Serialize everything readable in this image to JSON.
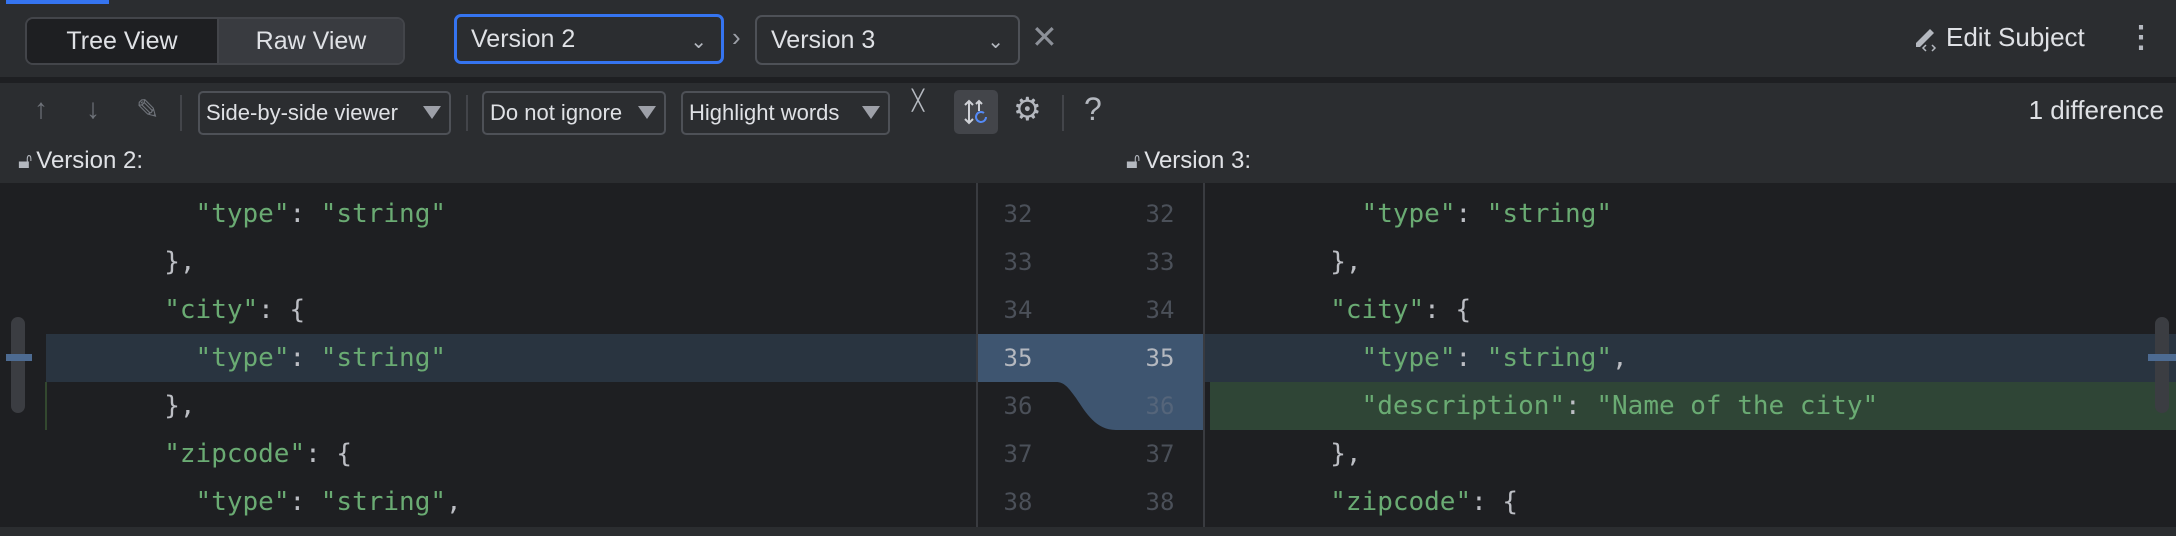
{
  "view_toggle": {
    "tree": "Tree View",
    "raw": "Raw View",
    "selected": "Tree View"
  },
  "compare": {
    "left": "Version 2",
    "right": "Version 3"
  },
  "edit_subject": "Edit Subject",
  "toolbar": {
    "viewer": "Side-by-side viewer",
    "ignore": "Do not ignore",
    "highlight": "Highlight words",
    "help": "?",
    "difference_count": "1 difference"
  },
  "left_title": "Version 2:",
  "right_title": "Version 3:",
  "colors": {
    "accent": "#3574f0",
    "changed": "#293440",
    "inserted": "#2f4536",
    "gutter_changed": "#3e5570",
    "string": "#6aab73"
  },
  "left_lines": [
    {
      "n": "32",
      "text": "          \"type\": \"string\""
    },
    {
      "n": "33",
      "text": "        },"
    },
    {
      "n": "34",
      "text": "        \"city\": {"
    },
    {
      "n": "35",
      "text": "          \"type\": \"string\"",
      "state": "changed"
    },
    {
      "n": "36",
      "text": "        },"
    },
    {
      "n": "37",
      "text": "        \"zipcode\": {"
    },
    {
      "n": "38",
      "text": "          \"type\": \"string\","
    }
  ],
  "right_lines": [
    {
      "n": "32",
      "text": "          \"type\": \"string\""
    },
    {
      "n": "33",
      "text": "        },"
    },
    {
      "n": "34",
      "text": "        \"city\": {"
    },
    {
      "n": "35",
      "text": "          \"type\": \"string\",",
      "state": "changed"
    },
    {
      "n": "36",
      "text": "          \"description\": \"Name of the city\"",
      "state": "inserted"
    },
    {
      "n": "37",
      "text": "        },"
    },
    {
      "n": "38",
      "text": "        \"zipcode\": {"
    }
  ]
}
